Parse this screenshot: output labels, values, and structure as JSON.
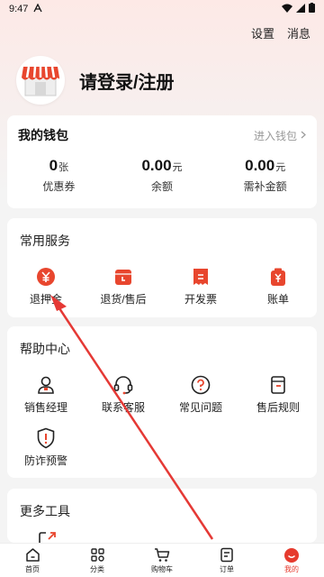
{
  "status_bar": {
    "time": "9:47"
  },
  "top_actions": {
    "settings": "设置",
    "messages": "消息"
  },
  "profile": {
    "login_text": "请登录/注册"
  },
  "wallet": {
    "title": "我的钱包",
    "link": "进入钱包",
    "stats": [
      {
        "value": "0",
        "unit": "张",
        "label": "优惠券"
      },
      {
        "value": "0.00",
        "unit": "元",
        "label": "余额"
      },
      {
        "value": "0.00",
        "unit": "元",
        "label": "需补金额"
      }
    ]
  },
  "services": {
    "title": "常用服务",
    "items": [
      {
        "label": "退押金",
        "icon": "deposit-refund-icon"
      },
      {
        "label": "退货/售后",
        "icon": "return-icon"
      },
      {
        "label": "开发票",
        "icon": "invoice-icon"
      },
      {
        "label": "账单",
        "icon": "bill-icon"
      }
    ]
  },
  "help": {
    "title": "帮助中心",
    "items": [
      {
        "label": "销售经理",
        "icon": "person-icon"
      },
      {
        "label": "联系客服",
        "icon": "headset-icon"
      },
      {
        "label": "常见问题",
        "icon": "question-icon"
      },
      {
        "label": "售后规则",
        "icon": "document-icon"
      },
      {
        "label": "防诈预警",
        "icon": "shield-alert-icon"
      }
    ]
  },
  "tools": {
    "title": "更多工具"
  },
  "tabbar": {
    "items": [
      {
        "label": "首页",
        "icon": "home-icon"
      },
      {
        "label": "分类",
        "icon": "category-icon"
      },
      {
        "label": "购物车",
        "icon": "cart-icon"
      },
      {
        "label": "订单",
        "icon": "order-icon"
      },
      {
        "label": "我的",
        "icon": "profile-icon",
        "active": true
      }
    ]
  },
  "colors": {
    "accent": "#e63b2e",
    "icon_red": "#e8462e",
    "arrow": "#e53935"
  }
}
